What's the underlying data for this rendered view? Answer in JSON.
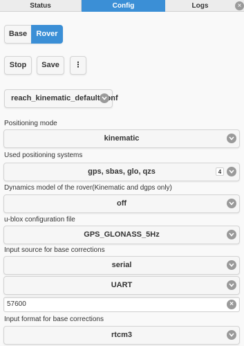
{
  "tabs": [
    {
      "label": "Status"
    },
    {
      "label": "Config"
    },
    {
      "label": "Logs"
    }
  ],
  "mode_toggle": {
    "base": "Base",
    "rover": "Rover"
  },
  "actions": {
    "stop": "Stop",
    "save": "Save",
    "more": "⋮"
  },
  "config_file": "reach_kinematic_default.conf",
  "fields": {
    "positioning_mode": {
      "label": "Positioning mode",
      "value": "kinematic"
    },
    "positioning_systems": {
      "label": "Used positioning systems",
      "value": "gps, sbas, glo, qzs",
      "count": "4"
    },
    "dynamics": {
      "label": "Dynamics model of the rover(Kinematic and dgps only)",
      "value": "off"
    },
    "ublox": {
      "label": "u-blox configuration file",
      "value": "GPS_GLONASS_5Hz"
    },
    "input_source": {
      "label": "Input source for base corrections",
      "value": "serial",
      "port": "UART",
      "baud": "57600"
    },
    "input_format": {
      "label": "Input format for base corrections",
      "value": "rtcm3"
    }
  },
  "colors": {
    "accent": "#3b8fd6",
    "icon_gray": "#9a9a9a"
  }
}
